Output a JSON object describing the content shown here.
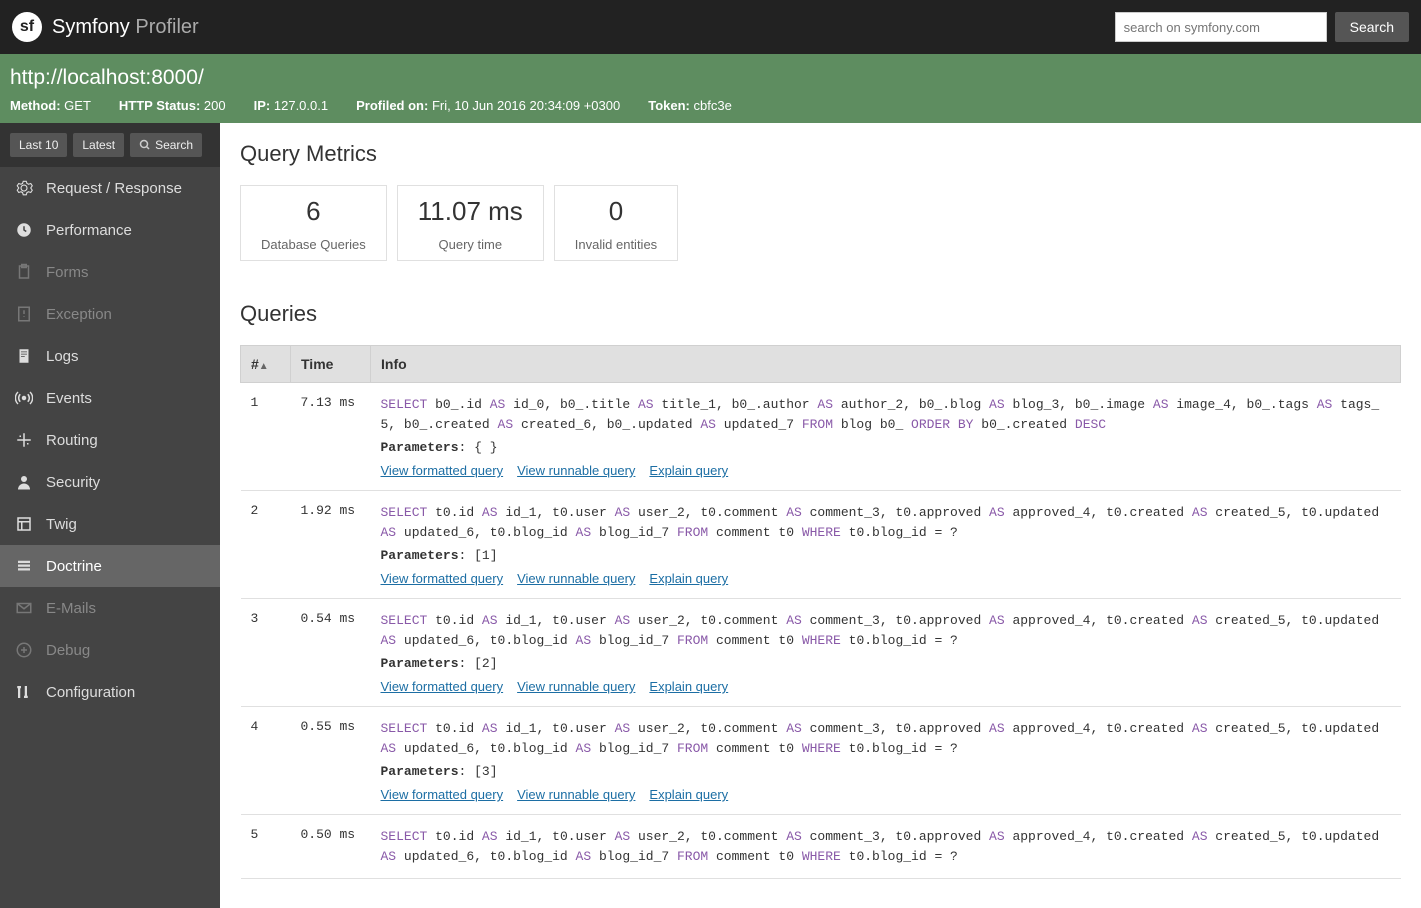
{
  "topbar": {
    "brand1": "Symfony",
    "brand2": " Profiler",
    "search_placeholder": "search on symfony.com",
    "search_btn": "Search"
  },
  "summary": {
    "url": "http://localhost:8000/",
    "method_label": "Method:",
    "method": "GET",
    "status_label": "HTTP Status:",
    "status": "200",
    "ip_label": "IP:",
    "ip": "127.0.0.1",
    "profiled_label": "Profiled on:",
    "profiled": "Fri, 10 Jun 2016 20:34:09 +0300",
    "token_label": "Token:",
    "token": "cbfc3e"
  },
  "shortcuts": {
    "last10": "Last 10",
    "latest": "Latest",
    "search": "Search"
  },
  "sidebar": {
    "items": [
      {
        "label": "Request / Response",
        "disabled": false
      },
      {
        "label": "Performance",
        "disabled": false
      },
      {
        "label": "Forms",
        "disabled": true
      },
      {
        "label": "Exception",
        "disabled": true
      },
      {
        "label": "Logs",
        "disabled": false
      },
      {
        "label": "Events",
        "disabled": false
      },
      {
        "label": "Routing",
        "disabled": false
      },
      {
        "label": "Security",
        "disabled": false
      },
      {
        "label": "Twig",
        "disabled": false
      },
      {
        "label": "Doctrine",
        "disabled": false,
        "active": true
      },
      {
        "label": "E-Mails",
        "disabled": true
      },
      {
        "label": "Debug",
        "disabled": true
      },
      {
        "label": "Configuration",
        "disabled": false
      }
    ]
  },
  "metrics": {
    "title": "Query Metrics",
    "items": [
      {
        "value": "6",
        "label": "Database Queries"
      },
      {
        "value": "11.07 ms",
        "label": "Query time"
      },
      {
        "value": "0",
        "label": "Invalid entities"
      }
    ]
  },
  "queries": {
    "title": "Queries",
    "columns": {
      "num": "#",
      "time": "Time",
      "info": "Info"
    },
    "link_formatted": "View formatted query",
    "link_runnable": "View runnable query",
    "link_explain": "Explain query",
    "params_label": "Parameters",
    "rows": [
      {
        "n": "1",
        "time": "7.13 ms",
        "sql": [
          [
            "kw",
            "SELECT"
          ],
          [
            "t",
            " b0_.id "
          ],
          [
            "kw",
            "AS"
          ],
          [
            "t",
            " id_0, b0_.title "
          ],
          [
            "kw",
            "AS"
          ],
          [
            "t",
            " title_1, b0_.author "
          ],
          [
            "kw",
            "AS"
          ],
          [
            "t",
            " author_2, b0_.blog "
          ],
          [
            "kw",
            "AS"
          ],
          [
            "t",
            " blog_3, b0_.image "
          ],
          [
            "kw",
            "AS"
          ],
          [
            "t",
            " image_4, b0_.tags "
          ],
          [
            "kw",
            "AS"
          ],
          [
            "t",
            " tags_5, b0_.created "
          ],
          [
            "kw",
            "AS"
          ],
          [
            "t",
            " created_6, b0_.updated "
          ],
          [
            "kw",
            "AS"
          ],
          [
            "t",
            " updated_7 "
          ],
          [
            "kw",
            "FROM"
          ],
          [
            "t",
            " blog b0_ "
          ],
          [
            "kw",
            "ORDER BY"
          ],
          [
            "t",
            " b0_.created "
          ],
          [
            "kw",
            "DESC"
          ]
        ],
        "params": "{ }"
      },
      {
        "n": "2",
        "time": "1.92 ms",
        "sql": [
          [
            "kw",
            "SELECT"
          ],
          [
            "t",
            " t0.id "
          ],
          [
            "kw",
            "AS"
          ],
          [
            "t",
            " id_1, t0.user "
          ],
          [
            "kw",
            "AS"
          ],
          [
            "t",
            " user_2, t0.comment "
          ],
          [
            "kw",
            "AS"
          ],
          [
            "t",
            " comment_3, t0.approved "
          ],
          [
            "kw",
            "AS"
          ],
          [
            "t",
            " approved_4, t0.created "
          ],
          [
            "kw",
            "AS"
          ],
          [
            "t",
            " created_5, t0.updated "
          ],
          [
            "kw",
            "AS"
          ],
          [
            "t",
            " updated_6, t0.blog_id "
          ],
          [
            "kw",
            "AS"
          ],
          [
            "t",
            " blog_id_7 "
          ],
          [
            "kw",
            "FROM"
          ],
          [
            "t",
            " comment t0 "
          ],
          [
            "kw",
            "WHERE"
          ],
          [
            "t",
            " t0.blog_id = ?"
          ]
        ],
        "params": "[1]"
      },
      {
        "n": "3",
        "time": "0.54 ms",
        "sql": [
          [
            "kw",
            "SELECT"
          ],
          [
            "t",
            " t0.id "
          ],
          [
            "kw",
            "AS"
          ],
          [
            "t",
            " id_1, t0.user "
          ],
          [
            "kw",
            "AS"
          ],
          [
            "t",
            " user_2, t0.comment "
          ],
          [
            "kw",
            "AS"
          ],
          [
            "t",
            " comment_3, t0.approved "
          ],
          [
            "kw",
            "AS"
          ],
          [
            "t",
            " approved_4, t0.created "
          ],
          [
            "kw",
            "AS"
          ],
          [
            "t",
            " created_5, t0.updated "
          ],
          [
            "kw",
            "AS"
          ],
          [
            "t",
            " updated_6, t0.blog_id "
          ],
          [
            "kw",
            "AS"
          ],
          [
            "t",
            " blog_id_7 "
          ],
          [
            "kw",
            "FROM"
          ],
          [
            "t",
            " comment t0 "
          ],
          [
            "kw",
            "WHERE"
          ],
          [
            "t",
            " t0.blog_id = ?"
          ]
        ],
        "params": "[2]"
      },
      {
        "n": "4",
        "time": "0.55 ms",
        "sql": [
          [
            "kw",
            "SELECT"
          ],
          [
            "t",
            " t0.id "
          ],
          [
            "kw",
            "AS"
          ],
          [
            "t",
            " id_1, t0.user "
          ],
          [
            "kw",
            "AS"
          ],
          [
            "t",
            " user_2, t0.comment "
          ],
          [
            "kw",
            "AS"
          ],
          [
            "t",
            " comment_3, t0.approved "
          ],
          [
            "kw",
            "AS"
          ],
          [
            "t",
            " approved_4, t0.created "
          ],
          [
            "kw",
            "AS"
          ],
          [
            "t",
            " created_5, t0.updated "
          ],
          [
            "kw",
            "AS"
          ],
          [
            "t",
            " updated_6, t0.blog_id "
          ],
          [
            "kw",
            "AS"
          ],
          [
            "t",
            " blog_id_7 "
          ],
          [
            "kw",
            "FROM"
          ],
          [
            "t",
            " comment t0 "
          ],
          [
            "kw",
            "WHERE"
          ],
          [
            "t",
            " t0.blog_id = ?"
          ]
        ],
        "params": "[3]"
      },
      {
        "n": "5",
        "time": "0.50 ms",
        "sql": [
          [
            "kw",
            "SELECT"
          ],
          [
            "t",
            " t0.id "
          ],
          [
            "kw",
            "AS"
          ],
          [
            "t",
            " id_1, t0.user "
          ],
          [
            "kw",
            "AS"
          ],
          [
            "t",
            " user_2, t0.comment "
          ],
          [
            "kw",
            "AS"
          ],
          [
            "t",
            " comment_3, t0.approved "
          ],
          [
            "kw",
            "AS"
          ],
          [
            "t",
            " approved_4, t0.created "
          ],
          [
            "kw",
            "AS"
          ],
          [
            "t",
            " created_5, t0.updated "
          ],
          [
            "kw",
            "AS"
          ],
          [
            "t",
            " updated_6, t0.blog_id "
          ],
          [
            "kw",
            "AS"
          ],
          [
            "t",
            " blog_id_7 "
          ],
          [
            "kw",
            "FROM"
          ],
          [
            "t",
            " comment t0 "
          ],
          [
            "kw",
            "WHERE"
          ],
          [
            "t",
            " t0.blog_id = ?"
          ]
        ],
        "params": ""
      }
    ]
  },
  "icons": {
    "request": "gear-icon",
    "performance": "clock-icon",
    "forms": "clipboard-icon",
    "exception": "warning-icon",
    "logs": "file-icon",
    "events": "broadcast-icon",
    "routing": "route-icon",
    "security": "person-icon",
    "twig": "layout-icon",
    "doctrine": "database-icon",
    "emails": "mail-icon",
    "debug": "plus-icon",
    "configuration": "tools-icon"
  }
}
